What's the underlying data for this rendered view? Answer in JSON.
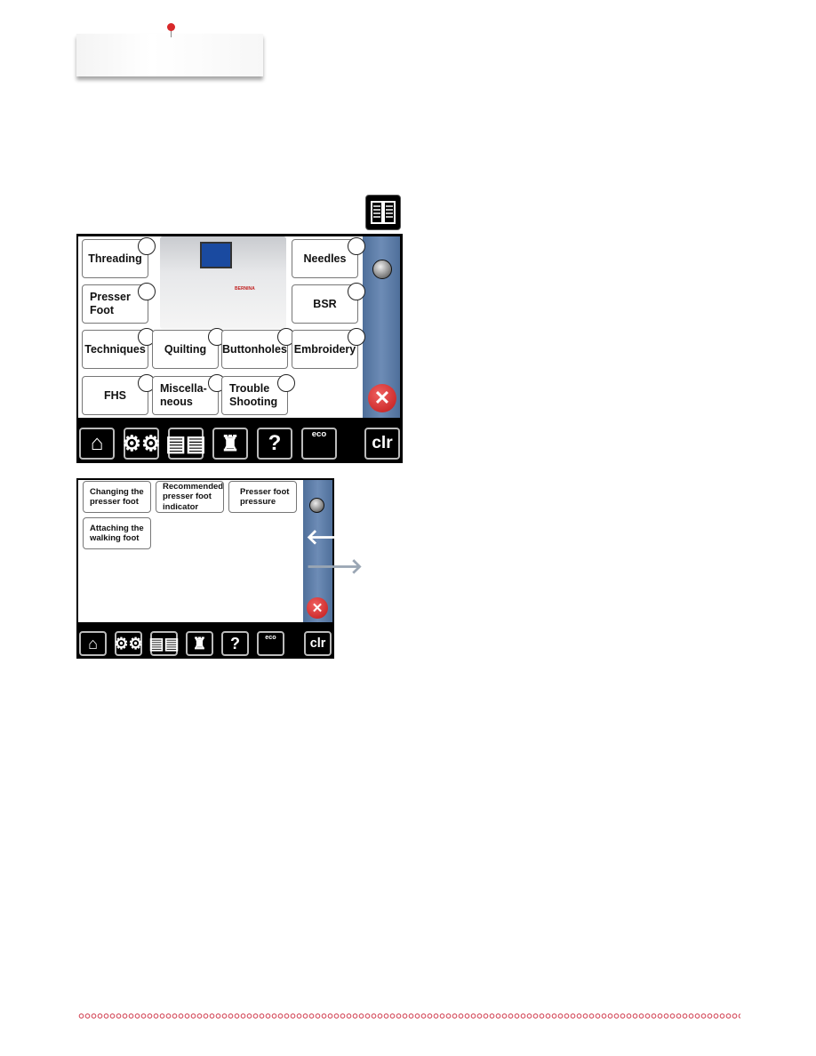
{
  "main_screen": {
    "topics": [
      {
        "label": "Threading"
      },
      {
        "label": "Needles"
      },
      {
        "label": "Presser\nFoot"
      },
      {
        "label": "BSR"
      },
      {
        "label": "Techniques"
      },
      {
        "label": "Quilting"
      },
      {
        "label": "Buttonholes"
      },
      {
        "label": "Embroidery"
      },
      {
        "label": "FHS"
      },
      {
        "label": "Miscella-\nneous"
      },
      {
        "label": "Trouble\nShooting"
      }
    ],
    "machine_brand": "BERNINA"
  },
  "sub_screen": {
    "topics": [
      {
        "label": "Changing the\npresser foot"
      },
      {
        "label": "Recommended\npresser foot\nindicator"
      },
      {
        "label": "Presser foot\npressure"
      },
      {
        "label": "Attaching the\nwalking foot"
      }
    ]
  },
  "toolbar": {
    "icons": [
      "home-icon",
      "settings-icon",
      "tutorial-book-icon",
      "sewing-consultant-icon",
      "help-icon",
      "eco-icon"
    ],
    "eco_label": "eco",
    "help_label": "?",
    "clr_label": "clr"
  },
  "colors": {
    "sidebar": "#6d8cb6",
    "close": "#d02020",
    "border": "#d44a5a"
  }
}
